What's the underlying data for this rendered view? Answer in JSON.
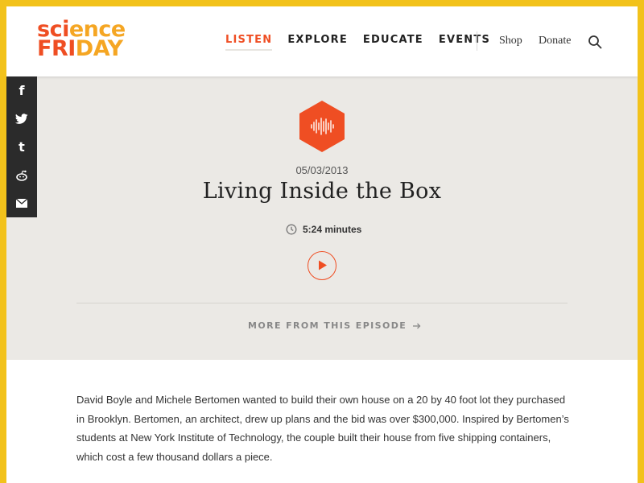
{
  "logo": {
    "line1_a": "sci",
    "line1_b": "ence",
    "line2_a": "FRI",
    "line2_b": "DAY"
  },
  "nav": {
    "items": [
      "LISTEN",
      "EXPLORE",
      "EDUCATE",
      "EVENTS"
    ],
    "active": "LISTEN"
  },
  "utility": {
    "shop": "Shop",
    "donate": "Donate"
  },
  "share": {
    "icons": [
      "facebook-icon",
      "twitter-icon",
      "tumblr-icon",
      "reddit-icon",
      "email-icon"
    ],
    "glyphs": [
      "f",
      "t",
      "reddit",
      "mail"
    ]
  },
  "segment": {
    "date": "05/03/2013",
    "title": "Living Inside the Box",
    "duration": "5:24 minutes",
    "more_label": "MORE FROM THIS EPISODE"
  },
  "body": {
    "paragraph": "David Boyle and Michele Bertomen wanted to build their own house on a 20 by 40 foot lot they purchased in Brooklyn. Bertomen, an architect, drew up plans and the bid was over $300,000. Inspired by Bertomen’s students at New York Institute of Technology, the couple built their house from five shipping containers, which cost a few thousand dollars a piece."
  },
  "colors": {
    "frame": "#f2c21b",
    "accent": "#ef4e23",
    "logo_yellow": "#f5a623",
    "hero_bg": "#ebe9e5",
    "share_bg": "#2b2b2b"
  }
}
